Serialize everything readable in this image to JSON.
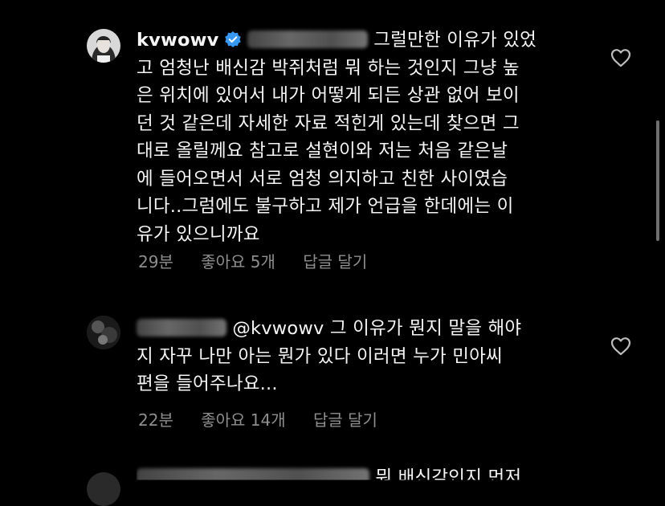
{
  "comments": [
    {
      "username": "kvwowv",
      "verified": true,
      "lines": [
        "그럴만한 이유가 있었",
        "고 엄청난 배신감 박쥐처럼 뭐 하는 것인지 그냥 높",
        "은 위치에 있어서 내가 어떻게 되든 상관 없어 보이",
        "던 것 같은데 자세한 자료 적힌게 있는데 찾으면 그",
        "대로 올릴께요 참고로 설현이와 저는 처음 같은날",
        "에 들어오면서 서로 엄청 의지하고 친한 사이였습",
        "니다..그럼에도 불구하고 제가 언급을 한데에는 이",
        "유가 있으니까요"
      ],
      "time": "29분",
      "likes": "좋아요 5개",
      "reply": "답글 달기"
    },
    {
      "mention": "@kvwowv",
      "lines": [
        "그 이유가 뭔지 말을 해야",
        "지 자꾸 나만 아는 뭔가 있다 이러면 누가 민아씨",
        "편을 들어주나요..."
      ],
      "time": "22분",
      "likes": "좋아요 14개",
      "reply": "답글 달기"
    }
  ],
  "partial_third_line": "뭐 배신감인지 먼저",
  "colors": {
    "background": "#000000",
    "text": "#f5f5f5",
    "meta": "#8e8e8e",
    "verified": "#3897f0"
  },
  "icons": [
    "heart-outline-icon",
    "verified-badge-icon"
  ]
}
